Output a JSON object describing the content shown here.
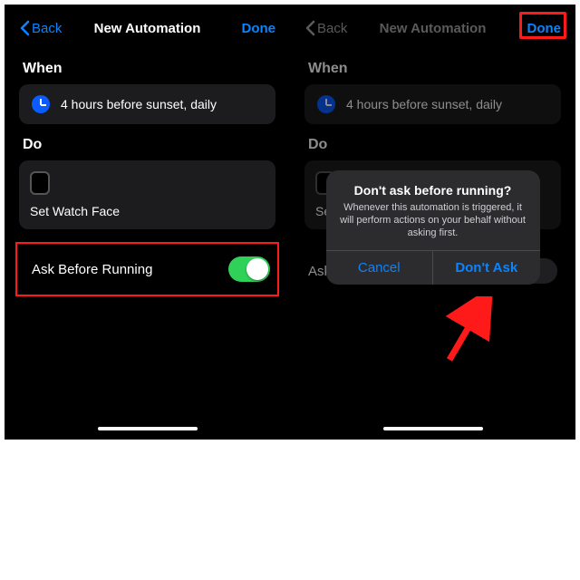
{
  "nav": {
    "back": "Back",
    "title": "New Automation",
    "done": "Done"
  },
  "sections": {
    "when": "When",
    "do": "Do"
  },
  "when_item": "4 hours before sunset, daily",
  "do_item": "Set Watch Face",
  "ask_row": "Ask Before Running",
  "dialog": {
    "title": "Don't ask before running?",
    "message": "Whenever this automation is triggered, it will perform actions on your behalf without asking first.",
    "cancel": "Cancel",
    "confirm": "Don't Ask"
  }
}
